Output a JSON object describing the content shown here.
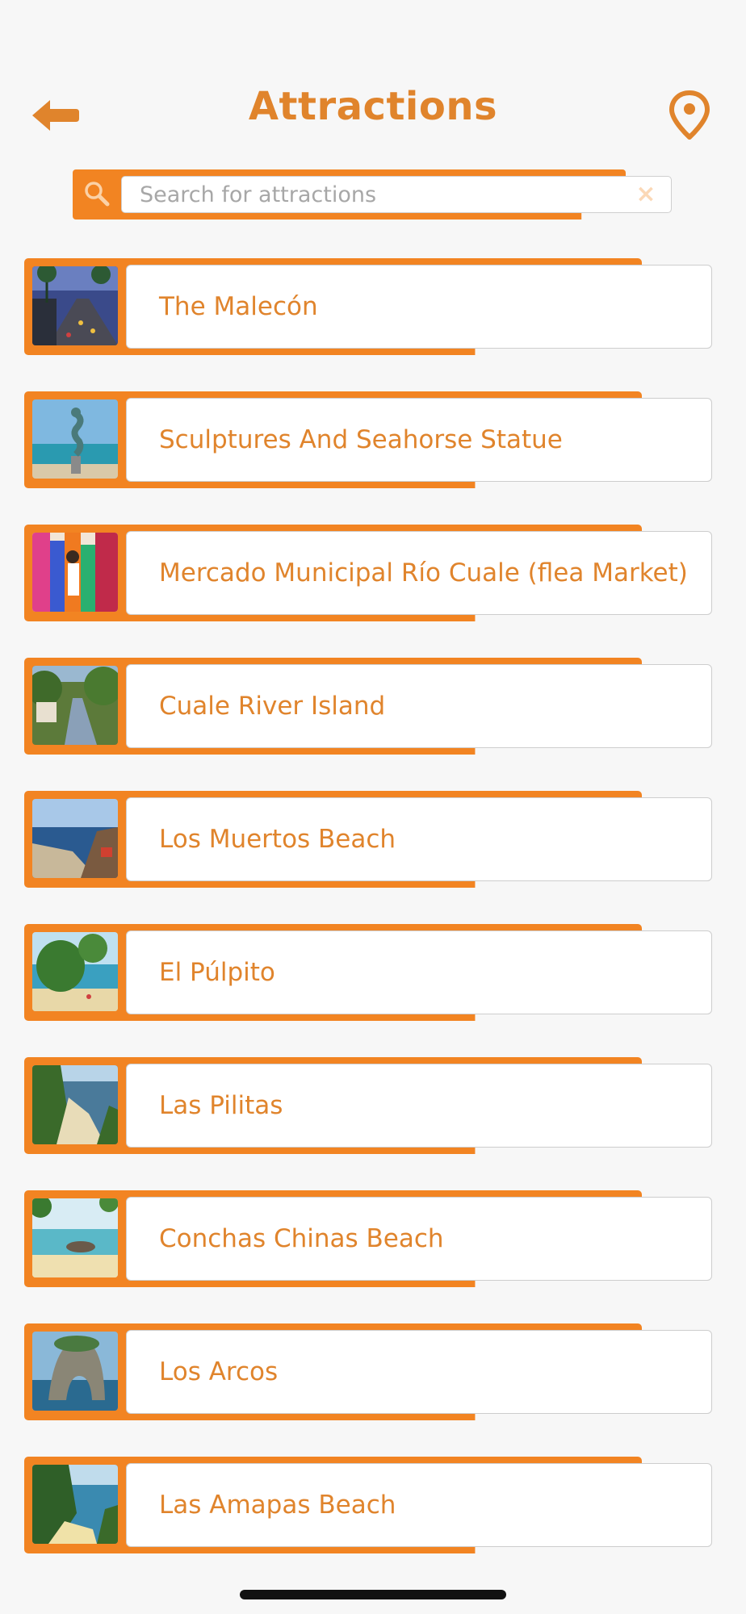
{
  "header": {
    "title": "Attractions"
  },
  "search": {
    "placeholder": "Search for attractions",
    "value": "",
    "clear_glyph": "×"
  },
  "colors": {
    "accent": "#f28422",
    "text_accent": "#e0842c",
    "background": "#f7f7f7"
  },
  "icons": {
    "back": "back-arrow-icon",
    "location": "location-pin-icon",
    "search": "search-icon",
    "clear": "clear-icon"
  },
  "attractions": [
    {
      "name": "The Malecón"
    },
    {
      "name": "Sculptures And Seahorse Statue"
    },
    {
      "name": "Mercado Municipal Río Cuale (flea Market)"
    },
    {
      "name": "Cuale River Island"
    },
    {
      "name": "Los Muertos Beach"
    },
    {
      "name": "El Púlpito"
    },
    {
      "name": "Las Pilitas"
    },
    {
      "name": "Conchas Chinas Beach"
    },
    {
      "name": "Los Arcos"
    },
    {
      "name": "Las Amapas Beach"
    }
  ]
}
